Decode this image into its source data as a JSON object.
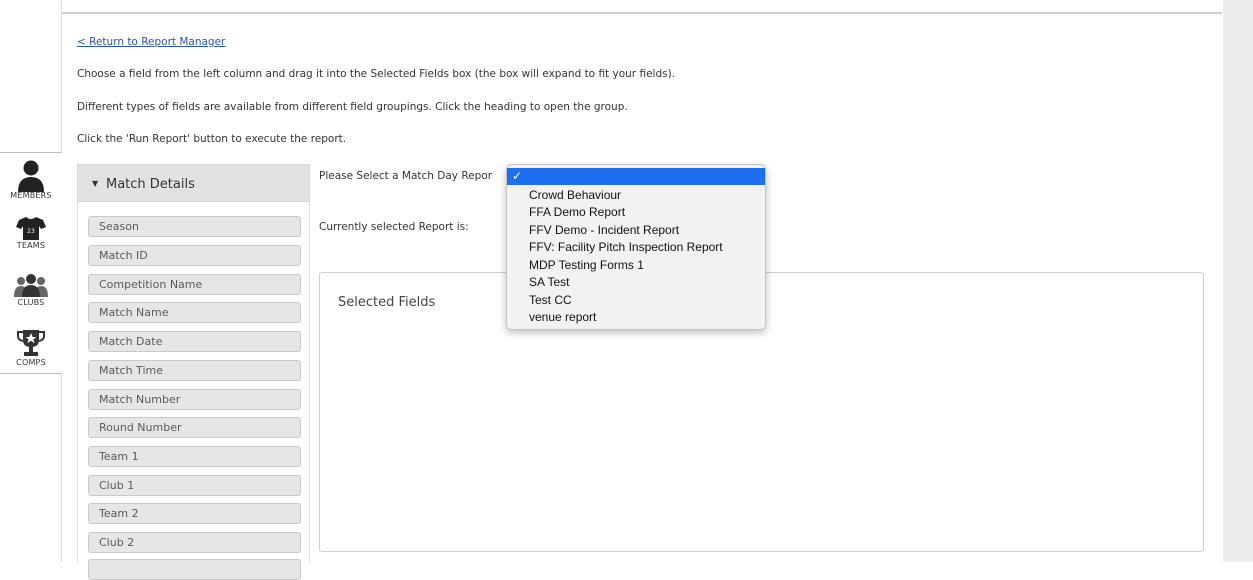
{
  "nav": {
    "members": "MEMBERS",
    "teams": "TEAMS",
    "clubs": "CLUBS",
    "comps": "COMPS",
    "jersey_number": "23"
  },
  "header": {
    "return_link": "< Return to Report Manager",
    "instruction_1": "Choose a field from the left column and drag it into the Selected Fields box (the box will expand to fit your fields).",
    "instruction_2": "Different types of fields are available from different field groupings. Click the heading to open the group.",
    "instruction_3": "Click the 'Run Report' button to execute the report."
  },
  "field_group": {
    "title": "Match Details",
    "fields": [
      "Season",
      "Match ID",
      "Competition Name",
      "Match Name",
      "Match Date",
      "Match Time",
      "Match Number",
      "Round Number",
      "Team 1",
      "Club 1",
      "Team 2",
      "Club 2"
    ]
  },
  "report_select": {
    "label": "Please Select a Match Day Repor",
    "current_label": "Currently selected Report is:",
    "selected_marker": "✓",
    "options": [
      "Crowd Behaviour",
      "FFA Demo Report",
      "FFV Demo - Incident Report",
      "FFV: Facility Pitch Inspection Report",
      "MDP Testing Forms 1",
      "SA Test",
      "Test CC",
      "venue report"
    ]
  },
  "selected_fields": {
    "title": "Selected Fields"
  },
  "colors": {
    "link": "#2a55b5",
    "selection": "#1e6ef0",
    "field_bg": "#e6e6e6"
  }
}
